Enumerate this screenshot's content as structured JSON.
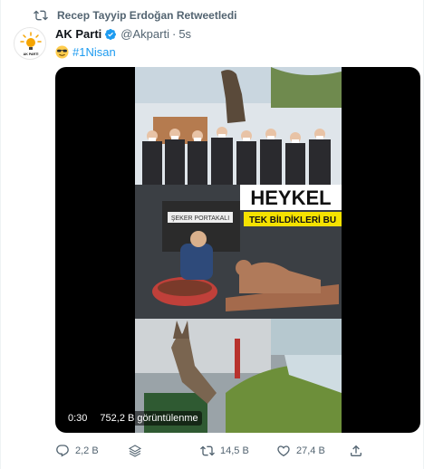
{
  "retweet": {
    "label": "Recep Tayyip Erdoğan Retweetledi"
  },
  "author": {
    "name": "AK Parti",
    "handle": "@Akparti",
    "separator": "·",
    "time": "5s",
    "avatar_caption": "AK PARTİ"
  },
  "text": {
    "hashtag": "#1Nisan"
  },
  "media": {
    "overlay_heading": "HEYKEL",
    "overlay_sub": "TEK BİLDİKLERİ BU",
    "sign_text": "ŞEKER PORTAKALI",
    "time": "0:30",
    "views": "752,2 B görüntülenme"
  },
  "actions": {
    "replies": "2,2 B",
    "retweets": "14,5 B",
    "likes": "27,4 B"
  },
  "colors": {
    "accent": "#1d9bf0",
    "muted": "#536471",
    "overlay_yellow": "#f5e200"
  }
}
